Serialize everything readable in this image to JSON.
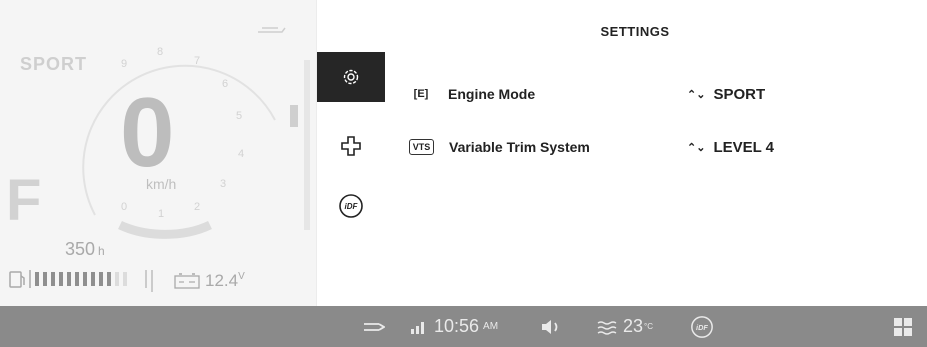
{
  "dashboard": {
    "ride_mode": "SPORT",
    "speed": "0",
    "speed_unit": "km/h",
    "gear": "F",
    "engine_hours": "350",
    "engine_hours_unit": "h",
    "battery_voltage": "12.4",
    "battery_unit": "V",
    "fuel_level": 0.85,
    "rpm_ticks": [
      "0",
      "1",
      "2",
      "3",
      "4",
      "5",
      "6",
      "7",
      "8",
      "9"
    ]
  },
  "sidebar": {
    "items": [
      {
        "name": "settings",
        "icon": "gear-icon",
        "active": true
      },
      {
        "name": "service",
        "icon": "cross-icon",
        "active": false
      },
      {
        "name": "idf",
        "icon": "idf-icon",
        "label": "iDF",
        "active": false
      }
    ]
  },
  "settings": {
    "title": "SETTINGS",
    "rows": [
      {
        "icon_text": "E",
        "label": "Engine Mode",
        "value": "SPORT"
      },
      {
        "icon_text": "VTS",
        "label": "Variable Trim System",
        "value": "LEVEL 4"
      }
    ]
  },
  "statusbar": {
    "time": "10:56",
    "ampm": "AM",
    "water_temp": "23",
    "temp_unit": "°C",
    "idf_label": "iDF"
  },
  "colors": {
    "statusbar_bg": "#8a8a8a",
    "active_icon_bg": "#262626",
    "text": "#222222"
  }
}
